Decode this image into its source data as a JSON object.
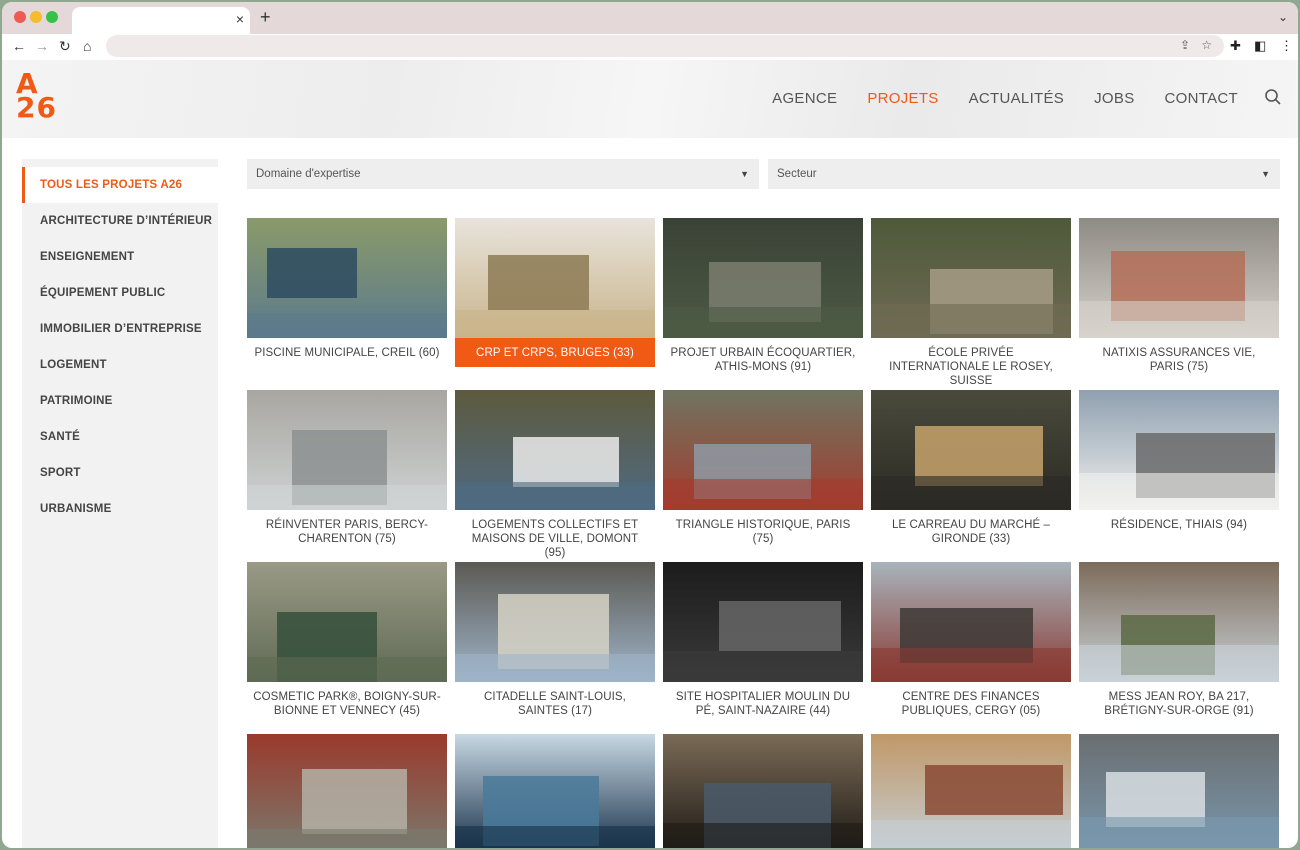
{
  "browser": {
    "tab_close": "×",
    "newtab": "+",
    "tab_menu": "⌄"
  },
  "site": {
    "logo_line1": "A",
    "logo_line2": "26",
    "brand_color": "#f05a14"
  },
  "nav": {
    "items": [
      "AGENCE",
      "PROJETS",
      "ACTUALITÉS",
      "JOBS",
      "CONTACT"
    ],
    "active": "PROJETS"
  },
  "sidebar": {
    "items": [
      "TOUS LES PROJETS A26",
      "ARCHITECTURE D’INTÉRIEUR",
      "ENSEIGNEMENT",
      "ÉQUIPEMENT PUBLIC",
      "IMMOBILIER D’ENTREPRISE",
      "LOGEMENT",
      "PATRIMOINE",
      "SANTÉ",
      "SPORT",
      "URBANISME"
    ]
  },
  "filters": {
    "expertise": "Domaine d'expertise",
    "secteur": "Secteur"
  },
  "projects": [
    {
      "caption": "PISCINE MUNICIPALE, CREIL (60)",
      "colors": [
        "#5b7a8c",
        "#2d4b60",
        "#8a9a6a"
      ]
    },
    {
      "caption": "CRP ET CRPS, BRUGES (33)",
      "colors": [
        "#c9b48a",
        "#8c7a54",
        "#e8e4dc"
      ]
    },
    {
      "caption": "PROJET URBAIN ÉCOQUARTIER, ATHIS-MONS (91)",
      "colors": [
        "#4d5a44",
        "#7b7e6e",
        "#3a4236"
      ]
    },
    {
      "caption": "ÉCOLE PRIVÉE INTERNATIONALE LE ROSEY, SUISSE",
      "colors": [
        "#6f6a54",
        "#a79c86",
        "#4e5a3a"
      ]
    },
    {
      "caption": "NATIXIS ASSURANCES VIE, PARIS (75)",
      "colors": [
        "#d7d2cc",
        "#b46f58",
        "#8e8a84"
      ]
    },
    {
      "caption": "RÉINVENTER PARIS, BERCY-CHARENTON (75)",
      "colors": [
        "#cfd3d4",
        "#8c9190",
        "#a8a6a0"
      ]
    },
    {
      "caption": "LOGEMENTS COLLECTIFS ET MAISONS DE VILLE, DOMONT (95)",
      "colors": [
        "#4f6a82",
        "#ebebea",
        "#5d5a3e"
      ]
    },
    {
      "caption": "TRIANGLE HISTORIQUE, PARIS (75)",
      "colors": [
        "#a33c2e",
        "#8e9aa4",
        "#6f7460"
      ]
    },
    {
      "caption": "LE CARREAU DU MARCHÉ – GIRONDE (33)",
      "colors": [
        "#2c2a24",
        "#c7a36c",
        "#4a4a3c"
      ]
    },
    {
      "caption": "RÉSIDENCE, THIAIS (94)",
      "colors": [
        "#f1f1ef",
        "#6a6a6a",
        "#8fa0b0"
      ]
    },
    {
      "caption": "COSMETIC PARK®, BOIGNY-SUR-BIONNE ET VENNECY (45)",
      "colors": [
        "#5f6a54",
        "#35503c",
        "#9a9a86"
      ]
    },
    {
      "caption": "CITADELLE SAINT-LOUIS, SAINTES (17)",
      "colors": [
        "#9fb4c8",
        "#d6d2c6",
        "#5c5a54"
      ]
    },
    {
      "caption": "SITE HOSPITALIER MOULIN DU PÉ, SAINT-NAZAIRE (44)",
      "colors": [
        "#3a3a3a",
        "#666666",
        "#1c1c1c"
      ]
    },
    {
      "caption": "CENTRE DES FINANCES PUBLIQUES, CERGY (05)",
      "colors": [
        "#8a3b34",
        "#3d3a36",
        "#a8b4bc"
      ]
    },
    {
      "caption": "MESS JEAN ROY, BA 217, BRÉTIGNY-SUR-ORGE (91)",
      "colors": [
        "#c9d2d8",
        "#5a6a44",
        "#7d6b5a"
      ]
    },
    {
      "caption": "",
      "colors": [
        "#7a7a6e",
        "#b4b0a6",
        "#9a3a2c"
      ]
    },
    {
      "caption": "",
      "colors": [
        "#163048",
        "#4a7a9a",
        "#c8d8e4"
      ]
    },
    {
      "caption": "",
      "colors": [
        "#1e1a16",
        "#4a5a6a",
        "#7a6a56"
      ]
    },
    {
      "caption": "",
      "colors": [
        "#c6cfd6",
        "#8a4a34",
        "#c09868"
      ]
    },
    {
      "caption": "",
      "colors": [
        "#7a98ae",
        "#d8dee2",
        "#6a6e70"
      ]
    }
  ],
  "active_project": 1
}
